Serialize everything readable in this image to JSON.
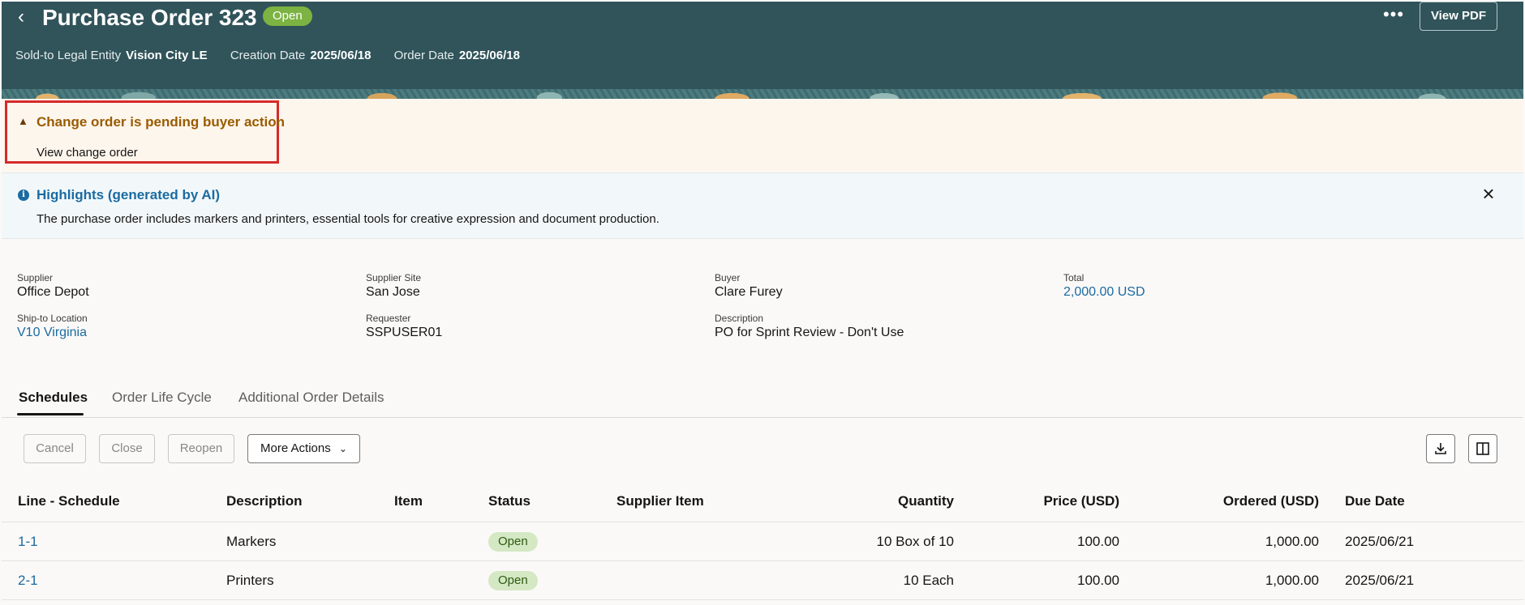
{
  "header": {
    "back_icon": "chevron-left-icon",
    "title": "Purchase Order 323",
    "status": "Open",
    "more_icon": "more-horizontal-icon",
    "view_pdf": "View PDF",
    "meta": [
      {
        "label": "Sold-to Legal Entity",
        "value": "Vision City LE"
      },
      {
        "label": "Creation Date",
        "value": "2025/06/18"
      },
      {
        "label": "Order Date",
        "value": "2025/06/18"
      }
    ]
  },
  "warning": {
    "icon": "warning-icon",
    "title": "Change order is pending buyer action",
    "link": "View change order"
  },
  "highlights": {
    "icon": "info-icon",
    "title": "Highlights (generated by AI)",
    "text": "The purchase order includes markers and printers, essential tools for creative expression and document production.",
    "close_icon": "close-icon"
  },
  "details": {
    "supplier": {
      "label": "Supplier",
      "value": "Office Depot"
    },
    "supplier_site": {
      "label": "Supplier Site",
      "value": "San Jose"
    },
    "buyer": {
      "label": "Buyer",
      "value": "Clare Furey"
    },
    "total": {
      "label": "Total",
      "value": "2,000.00 USD"
    },
    "ship_to": {
      "label": "Ship-to Location",
      "value": "V10 Virginia"
    },
    "requester": {
      "label": "Requester",
      "value": "SSPUSER01"
    },
    "description": {
      "label": "Description",
      "value": "PO for Sprint Review - Don't Use"
    }
  },
  "tabs": [
    {
      "label": "Schedules",
      "active": true
    },
    {
      "label": "Order Life Cycle",
      "active": false
    },
    {
      "label": "Additional Order Details",
      "active": false
    }
  ],
  "toolbar": {
    "cancel": "Cancel",
    "close": "Close",
    "reopen": "Reopen",
    "more_actions": "More Actions",
    "more_actions_icon": "chevron-down-icon",
    "download_icon": "download-icon",
    "columns_icon": "columns-icon"
  },
  "table": {
    "headers": [
      "Line - Schedule",
      "Description",
      "Item",
      "Status",
      "Supplier Item",
      "Quantity",
      "Price (USD)",
      "Ordered (USD)",
      "Due Date"
    ],
    "rows": [
      {
        "line": "1-1",
        "description": "Markers",
        "item": "",
        "status": "Open",
        "supplier_item": "",
        "quantity": "10 Box of 10",
        "price": "100.00",
        "ordered": "1,000.00",
        "due": "2025/06/21"
      },
      {
        "line": "2-1",
        "description": "Printers",
        "item": "",
        "status": "Open",
        "supplier_item": "",
        "quantity": "10 Each",
        "price": "100.00",
        "ordered": "1,000.00",
        "due": "2025/06/21"
      }
    ]
  },
  "colors": {
    "header_bg": "#30545a",
    "open_badge": "#7cb342",
    "warning_text": "#9a5b00",
    "link": "#1b6ba1",
    "highlight_border": "#d62a2a"
  }
}
